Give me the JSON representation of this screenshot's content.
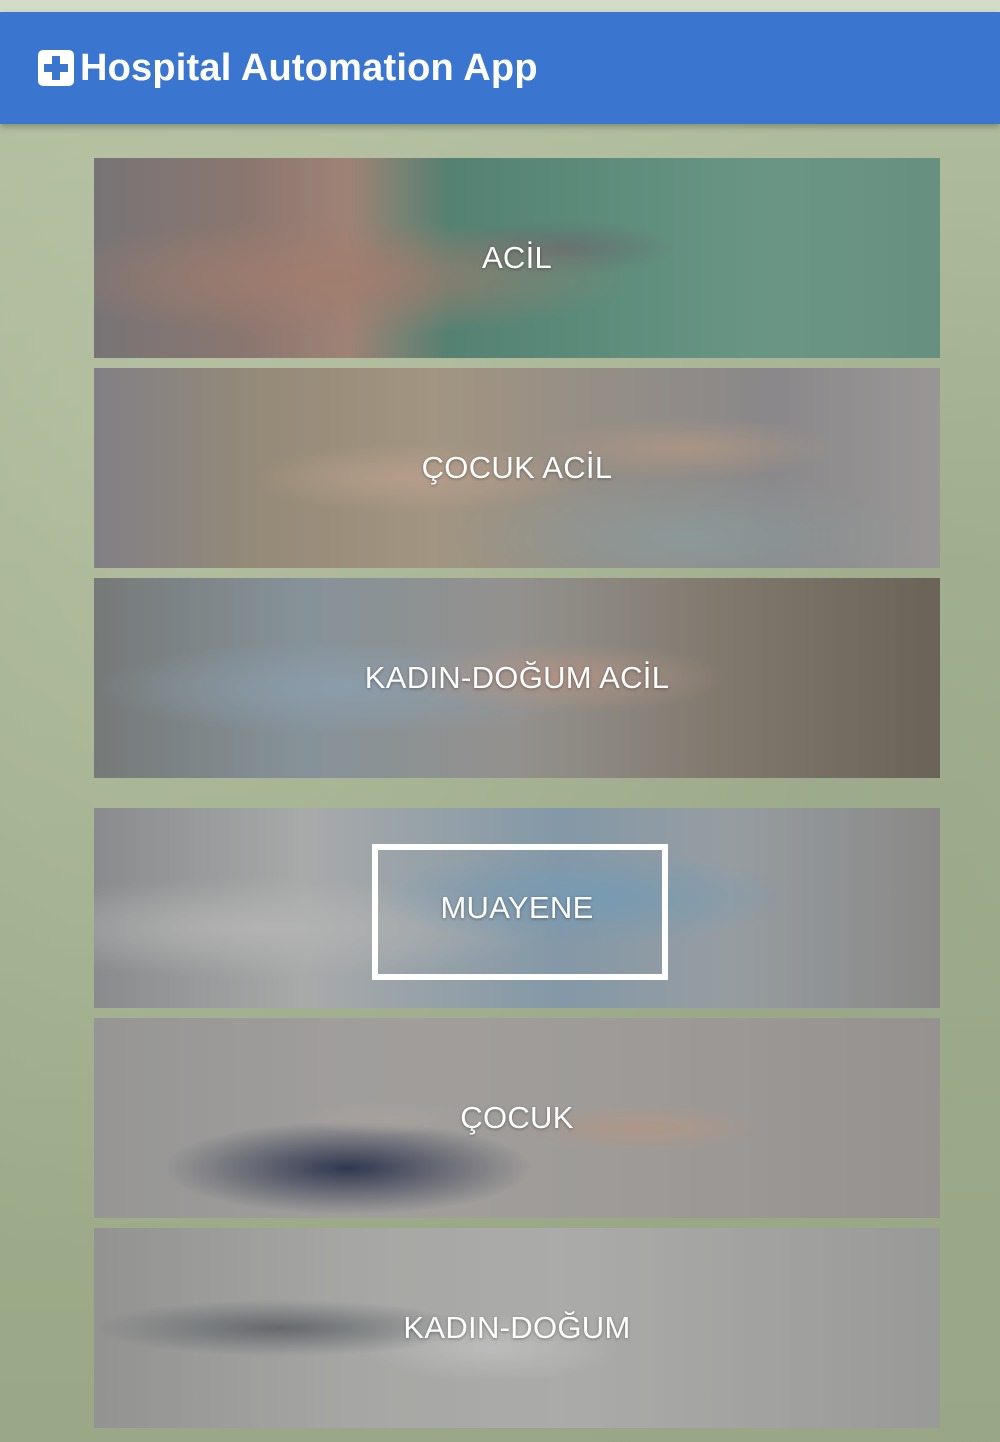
{
  "header": {
    "title": "Hospital Automation App",
    "icon": "hospital-cross-icon",
    "background_color": "#3a76cf"
  },
  "cards": [
    {
      "label": "ACİL"
    },
    {
      "label": "ÇOCUK ACİL"
    },
    {
      "label": "KADIN-DOĞUM ACİL"
    },
    {
      "label": "MUAYENE",
      "focused": true
    },
    {
      "label": "ÇOCUK"
    },
    {
      "label": "KADIN-DOĞUM"
    }
  ]
}
